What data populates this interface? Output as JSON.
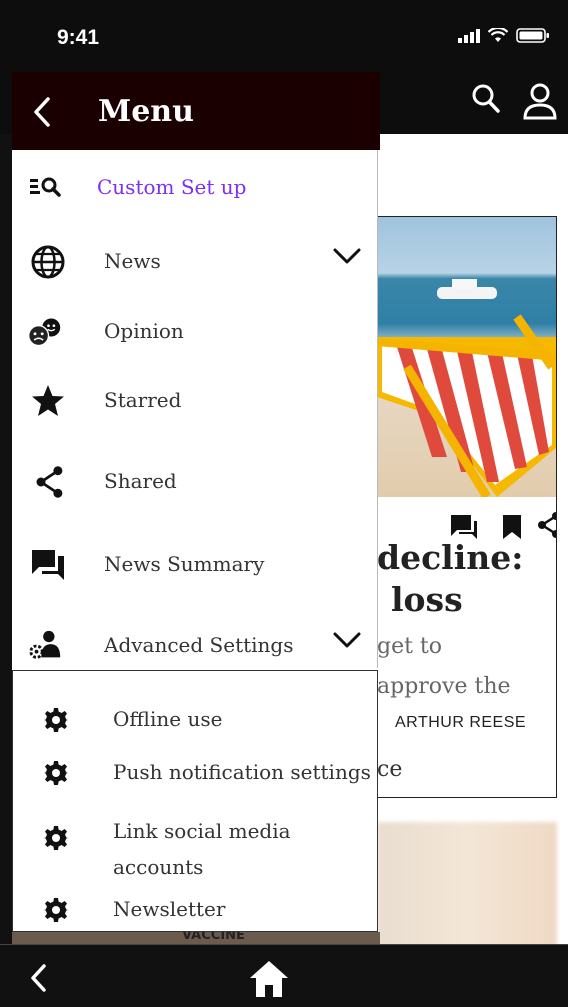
{
  "status": {
    "time": "9:41"
  },
  "drawer": {
    "title": "Menu",
    "items": [
      {
        "label": "Custom Set up",
        "icon": "custom-setup-icon",
        "color": "#7b2ff7"
      },
      {
        "label": "News",
        "icon": "globe-icon"
      },
      {
        "label": "Opinion",
        "icon": "opinion-faces-icon"
      },
      {
        "label": "Starred",
        "icon": "star-icon"
      },
      {
        "label": "Shared",
        "icon": "share-icon"
      },
      {
        "label": "News Summary",
        "icon": "chat-icon"
      },
      {
        "label": "Advanced Settings",
        "icon": "user-settings-icon"
      }
    ],
    "advanced": [
      {
        "label": "Offline use",
        "icon": "gear-icon"
      },
      {
        "label": "Push notification settings",
        "icon": "gear-icon"
      },
      {
        "label": "Link social media accounts",
        "icon": "gear-icon"
      },
      {
        "label": "Newsletter",
        "icon": "gear-icon"
      }
    ]
  },
  "article": {
    "headline_line1": "decline:",
    "headline_line2": "loss",
    "sub_line1": "get to",
    "sub_line2": "approve the",
    "author": "ARTHUR REESE",
    "extra": "ce",
    "caption": "VACCINE"
  },
  "colors": {
    "accent": "#7b2ff7",
    "drawer_header": "#1a0000",
    "bar": "#0d0d0d"
  }
}
